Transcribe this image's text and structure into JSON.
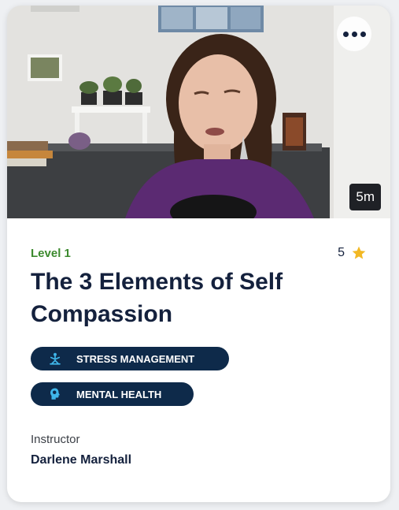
{
  "course": {
    "level": "Level 1",
    "rating": "5",
    "title": "The 3 Elements of Self Compassion",
    "duration": "5m",
    "tags": [
      {
        "label": "STRESS MANAGEMENT",
        "icon": "person-lotus-icon"
      },
      {
        "label": "MENTAL HEALTH",
        "icon": "head-brain-icon"
      }
    ],
    "instructor_label": "Instructor",
    "instructor_name": "Darlene Marshall"
  },
  "colors": {
    "level_green": "#3c8a2e",
    "navy": "#14213d",
    "tag_bg": "#0e2a4a",
    "tag_icon": "#3fb6ea",
    "star": "#f2b824"
  }
}
